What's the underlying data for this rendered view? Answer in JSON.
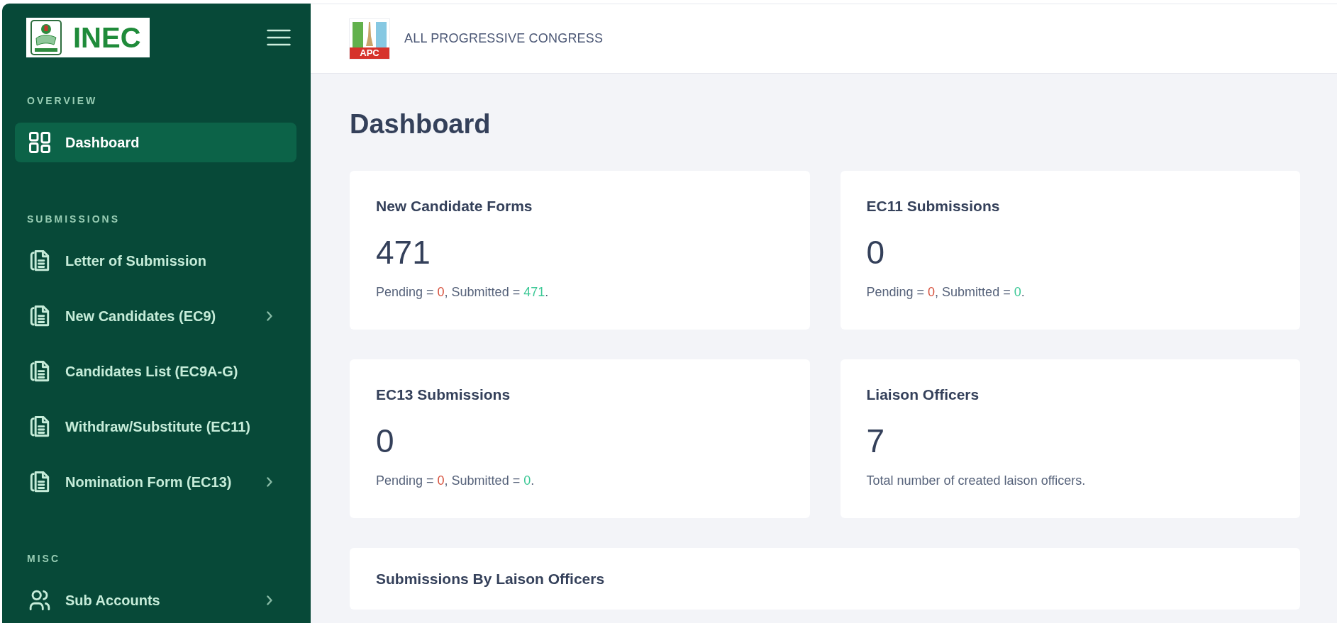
{
  "sidebar": {
    "logo_text": "INEC",
    "sections": [
      {
        "heading": "OVERVIEW",
        "items": [
          {
            "label": "Dashboard",
            "selected": true,
            "expandable": false
          }
        ]
      },
      {
        "heading": "SUBMISSIONS",
        "items": [
          {
            "label": "Letter of Submission",
            "selected": false,
            "expandable": false
          },
          {
            "label": "New Candidates (EC9)",
            "selected": false,
            "expandable": true
          },
          {
            "label": "Candidates List (EC9A-G)",
            "selected": false,
            "expandable": false
          },
          {
            "label": "Withdraw/Substitute (EC11)",
            "selected": false,
            "expandable": false
          },
          {
            "label": "Nomination Form (EC13)",
            "selected": false,
            "expandable": true
          }
        ]
      },
      {
        "heading": "MISC",
        "items": [
          {
            "label": "Sub Accounts",
            "selected": false,
            "expandable": true
          }
        ]
      }
    ]
  },
  "header": {
    "party_logo_text": "APC",
    "party_name": "ALL PROGRESSIVE CONGRESS"
  },
  "page_title": "Dashboard",
  "cards": [
    {
      "kind": "stat",
      "title": "New Candidate Forms",
      "value": "471",
      "detail": [
        {
          "text": "Pending = "
        },
        {
          "text": "0",
          "color": "#d6503c"
        },
        {
          "text": ", Submitted = "
        },
        {
          "text": "471",
          "color": "#3cc896"
        },
        {
          "text": "."
        }
      ]
    },
    {
      "kind": "stat",
      "title": "EC11 Submissions",
      "value": "0",
      "detail": [
        {
          "text": "Pending = "
        },
        {
          "text": "0",
          "color": "#d6503c"
        },
        {
          "text": ", Submitted = "
        },
        {
          "text": "0",
          "color": "#3cc896"
        },
        {
          "text": "."
        }
      ]
    },
    {
      "kind": "stat",
      "title": "EC13 Submissions",
      "value": "0",
      "detail": [
        {
          "text": "Pending = "
        },
        {
          "text": "0",
          "color": "#d6503c"
        },
        {
          "text": ", Submitted = "
        },
        {
          "text": "0",
          "color": "#3cc896"
        },
        {
          "text": "."
        }
      ]
    },
    {
      "kind": "stat",
      "title": "Liaison Officers",
      "value": "7",
      "detail": [
        {
          "text": "Total number of created laison officers."
        }
      ]
    },
    {
      "kind": "panel",
      "title": "Submissions By Laison Officers"
    }
  ]
}
